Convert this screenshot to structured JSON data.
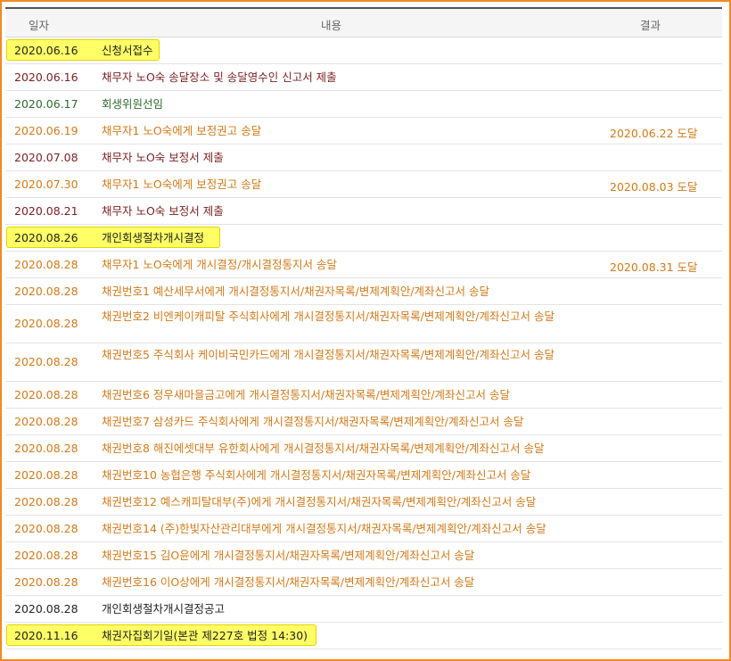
{
  "header": {
    "date": "일자",
    "content": "내용",
    "result": "결과"
  },
  "colors": {
    "black": "#222222",
    "brown": "#7a1f1f",
    "green": "#2e6b2e",
    "orange": "#d07a1a",
    "highlight": "#ffff66",
    "frame": "#f08a24"
  },
  "rows": [
    {
      "date": "2020.06.16",
      "content": "신청서접수",
      "result": "",
      "color": "black",
      "highlight": true
    },
    {
      "date": "2020.06.16",
      "content": "채무자 노O숙 송달장소 및 송달영수인 신고서 제출",
      "result": "",
      "color": "brown"
    },
    {
      "date": "2020.06.17",
      "content": "회생위원선임",
      "result": "",
      "color": "green"
    },
    {
      "date": "2020.06.19",
      "content": "채무자1 노O숙에게 보정권고 송달",
      "result": "2020.06.22 도달",
      "color": "orange"
    },
    {
      "date": "2020.07.08",
      "content": "채무자 노O숙 보정서 제출",
      "result": "",
      "color": "brown"
    },
    {
      "date": "2020.07.30",
      "content": "채무자1 노O숙에게 보정권고 송달",
      "result": "2020.08.03 도달",
      "color": "orange"
    },
    {
      "date": "2020.08.21",
      "content": "채무자 노O숙 보정서 제출",
      "result": "",
      "color": "brown"
    },
    {
      "date": "2020.08.26",
      "content": "개인회생절차개시결정",
      "result": "",
      "color": "black",
      "highlight": true
    },
    {
      "date": "2020.08.28",
      "content": "채무자1 노O숙에게 개시결정/개시결정통지서 송달",
      "result": "2020.08.31 도달",
      "color": "orange"
    },
    {
      "date": "2020.08.28",
      "content": "채권번호1 예산세무서에게 개시결정통지서/채권자목록/변제계획안/계좌신고서 송달",
      "result": "",
      "color": "orange"
    },
    {
      "date": "2020.08.28",
      "content": "채권번호2 비엔케이캐피탈 주식회사에게 개시결정통지서/채권자목록/변제계획안/계좌신고서 송달",
      "result": "",
      "color": "orange",
      "tall": true
    },
    {
      "date": "2020.08.28",
      "content": "채권번호5 주식회사 케이비국민카드에게 개시결정통지서/채권자목록/변제계획안/계좌신고서 송달",
      "result": "",
      "color": "orange",
      "tall": true
    },
    {
      "date": "2020.08.28",
      "content": "채권번호6 정우새마을금고에게 개시결정통지서/채권자목록/변제계획안/계좌신고서 송달",
      "result": "",
      "color": "orange"
    },
    {
      "date": "2020.08.28",
      "content": "채권번호7 삼성카드 주식회사에게 개시결정통지서/채권자목록/변제계획안/계좌신고서 송달",
      "result": "",
      "color": "orange"
    },
    {
      "date": "2020.08.28",
      "content": "채권번호8 해진에셋대부 유한회사에게 개시결정통지서/채권자목록/변제계획안/계좌신고서 송달",
      "result": "",
      "color": "orange"
    },
    {
      "date": "2020.08.28",
      "content": "채권번호10 농협은행 주식회사에게 개시결정통지서/채권자목록/변제계획안/계좌신고서 송달",
      "result": "",
      "color": "orange"
    },
    {
      "date": "2020.08.28",
      "content": "채권번호12 예스캐피탈대부(주)에게 개시결정통지서/채권자목록/변제계획안/계좌신고서 송달",
      "result": "",
      "color": "orange"
    },
    {
      "date": "2020.08.28",
      "content": "채권번호14 (주)한빛자산관리대부에게 개시결정통지서/채권자목록/변제계획안/계좌신고서 송달",
      "result": "",
      "color": "orange"
    },
    {
      "date": "2020.08.28",
      "content": "채권번호15 김O윤에게 개시결정통지서/채권자목록/변제계획안/계좌신고서 송달",
      "result": "",
      "color": "orange"
    },
    {
      "date": "2020.08.28",
      "content": "채권번호16 이O상에게 개시결정통지서/채권자목록/변제계획안/계좌신고서 송달",
      "result": "",
      "color": "orange"
    },
    {
      "date": "2020.08.28",
      "content": "개인회생절차개시결정공고",
      "result": "",
      "color": "black"
    },
    {
      "date": "2020.11.16",
      "content": "채권자집회기일(본관 제227호 법정 14:30)",
      "result": "",
      "color": "black",
      "highlight": true
    }
  ]
}
